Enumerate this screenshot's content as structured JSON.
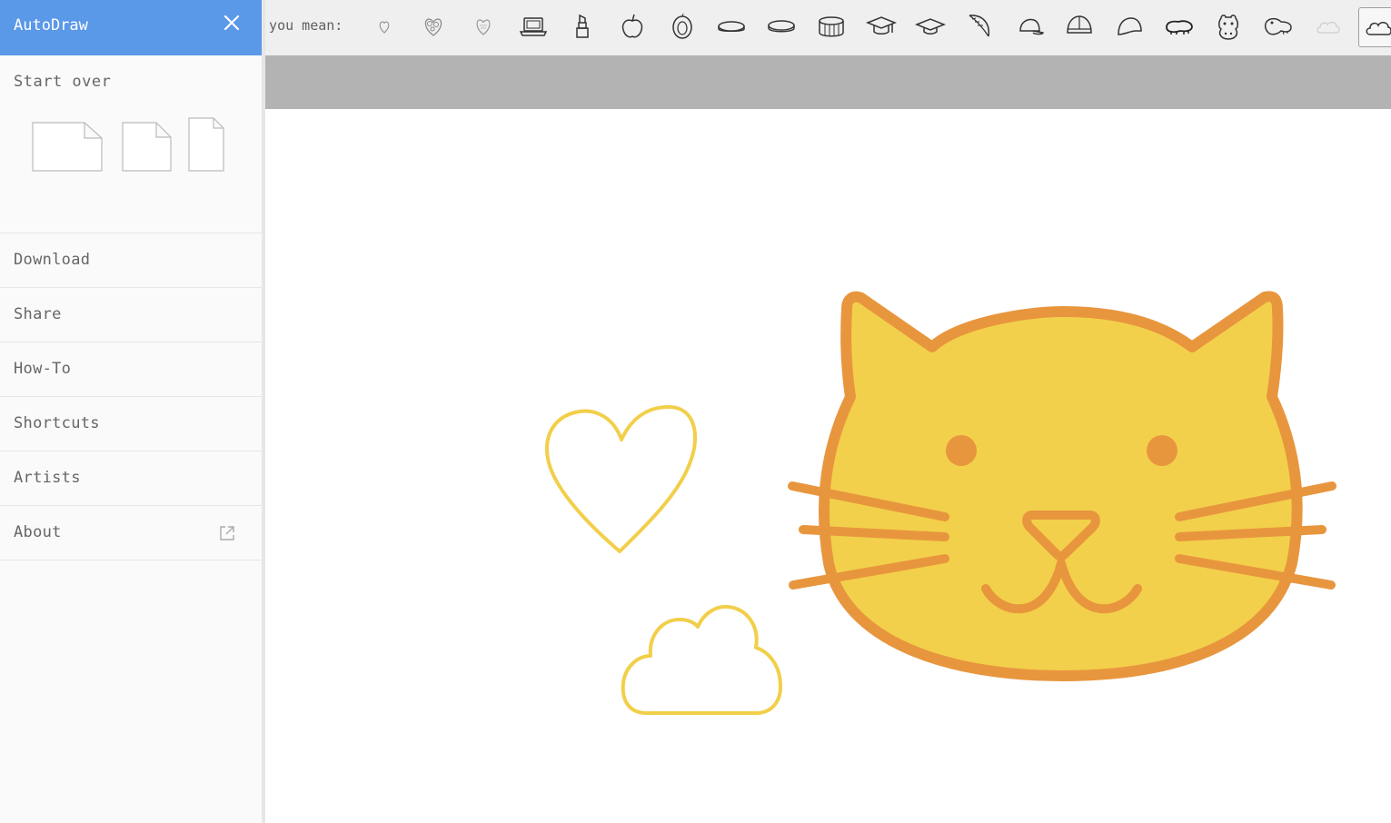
{
  "app": {
    "title": "AutoDraw"
  },
  "suggestions": {
    "prompt": "o you mean:",
    "items": [
      "heart-icon",
      "heart-flowers-icon",
      "heart-lines-icon",
      "laptop-icon",
      "lipstick-icon",
      "apple-icon",
      "peach-icon",
      "coin-icon",
      "coin-flat-icon",
      "drum-icon",
      "graduation-cap-icon",
      "graduation-hat-icon",
      "feather-icon",
      "baseball-cap-icon",
      "helmet-icon",
      "cap-icon",
      "hippo-side-icon",
      "hippo-face-icon",
      "hippo-head-icon",
      "cloud-faint-icon",
      "cloud-icon"
    ]
  },
  "sidebar": {
    "start_over": "Start over",
    "formats": [
      "landscape-page-icon",
      "square-page-icon",
      "portrait-page-icon"
    ],
    "menu": {
      "download": "Download",
      "share": "Share",
      "howto": "How-To",
      "shortcuts": "Shortcuts",
      "artists": "Artists",
      "about": "About"
    }
  },
  "colors": {
    "sidebar_header": "#5a98e8",
    "cat_fill": "#f3d04b",
    "cat_stroke": "#e8963e",
    "heart_cloud_stroke": "#f2cf4a",
    "gray_bar": "#b3b3b3"
  }
}
